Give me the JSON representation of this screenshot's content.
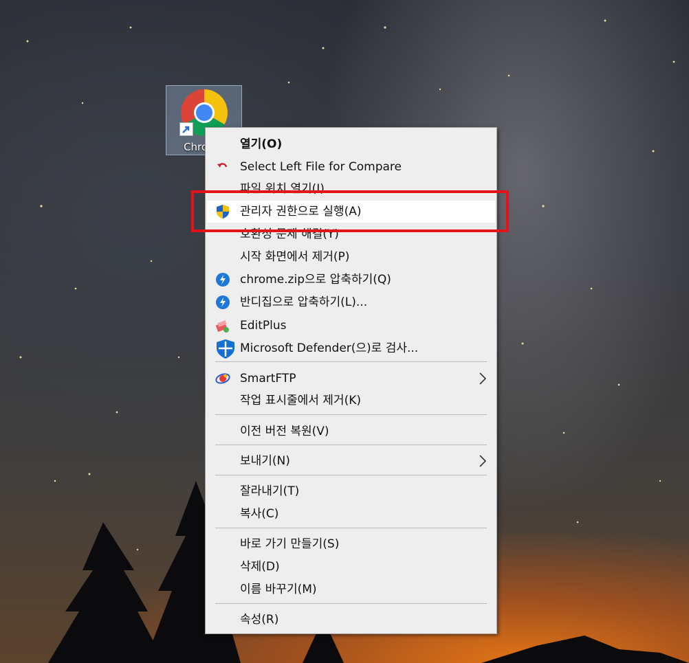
{
  "desktop": {
    "shortcut": {
      "label": "Chrome",
      "icon": "chrome-icon"
    }
  },
  "menu": {
    "items": [
      {
        "label": "열기(O)",
        "icon": ""
      },
      {
        "label": "Select Left File for Compare",
        "icon": "undo-arrow-icon"
      },
      {
        "label": "파일 위치 열기(I)",
        "icon": ""
      },
      {
        "label": "관리자 권한으로 실행(A)",
        "icon": "uac-shield-icon"
      },
      {
        "label": "호환성 문제 해결(Y)",
        "icon": ""
      },
      {
        "label": "시작 화면에서 제거(P)",
        "icon": ""
      },
      {
        "label": "chrome.zip으로 압축하기(Q)",
        "icon": "bandizip-icon"
      },
      {
        "label": "반디집으로 압축하기(L)...",
        "icon": "bandizip-icon"
      },
      {
        "label": "EditPlus",
        "icon": "editplus-icon"
      },
      {
        "label": "Microsoft Defender(으)로 검사...",
        "icon": "defender-icon"
      },
      {
        "label": "SmartFTP",
        "icon": "smartftp-icon"
      },
      {
        "label": "작업 표시줄에서 제거(K)",
        "icon": ""
      },
      {
        "label": "이전 버전 복원(V)",
        "icon": ""
      },
      {
        "label": "보내기(N)",
        "icon": ""
      },
      {
        "label": "잘라내기(T)",
        "icon": ""
      },
      {
        "label": "복사(C)",
        "icon": ""
      },
      {
        "label": "바로 가기 만들기(S)",
        "icon": ""
      },
      {
        "label": "삭제(D)",
        "icon": ""
      },
      {
        "label": "이름 바꾸기(M)",
        "icon": ""
      },
      {
        "label": "속성(R)",
        "icon": ""
      }
    ]
  },
  "colors": {
    "menu_bg": "#eeeeee",
    "hover_bg": "#ffffff",
    "highlight_border": "#e3121b",
    "bandizip_blue": "#1e78d6"
  }
}
